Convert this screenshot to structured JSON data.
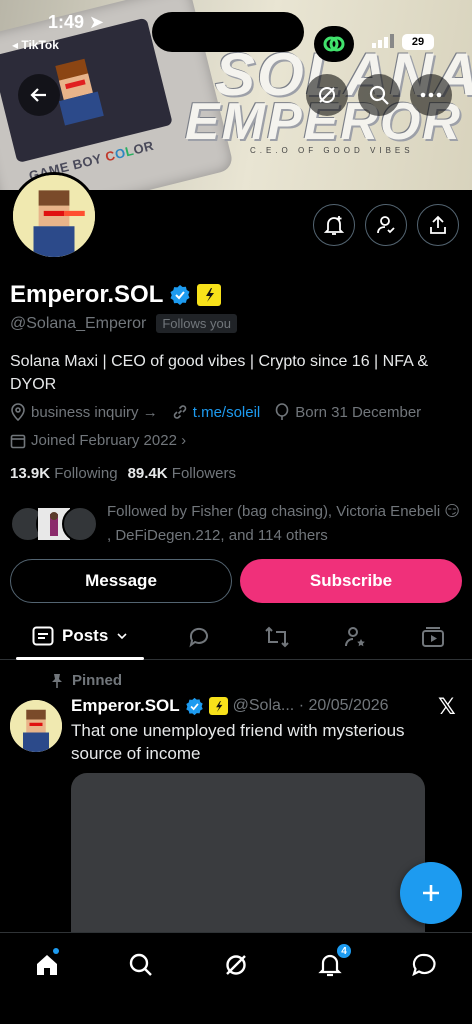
{
  "status_bar": {
    "time": "1:49",
    "back_app": "◂ TikTok",
    "battery": "29"
  },
  "banner": {
    "device_label": [
      "GAME BOY ",
      "C",
      "O",
      "L",
      "OR"
    ],
    "brand_line1": "SOLANA",
    "brand_line2": "EMPEROR",
    "tagline": "C.E.O OF GOOD VIBES"
  },
  "profile": {
    "name": "Emperor.SOL",
    "handle": "@Solana_Emperor",
    "follows_you": "Follows you",
    "bio": "Solana Maxi | CEO of good vibes | Crypto since 16 | NFA & DYOR",
    "business_inquiry": "business inquiry →",
    "link": "t.me/soleil",
    "born": "Born 31 December",
    "joined": "Joined February 2022 ›",
    "following_count": "13.9K",
    "following_label": "Following",
    "followers_count": "89.4K",
    "followers_label": "Followers",
    "followed_by": "Followed by Fisher (bag chasing), Victoria Enebeli 😏 , DeFiDegen.212, and 114 others"
  },
  "buttons": {
    "message": "Message",
    "subscribe": "Subscribe"
  },
  "tabs": {
    "active_label": "Posts"
  },
  "post": {
    "pinned_label": "Pinned",
    "author": "Emperor.SOL",
    "handle_date": "@Sola... · 20/05/2026",
    "text": "That one unemployed friend with mysterious source of income"
  },
  "bottom_nav": {
    "notifications_badge": "4"
  },
  "colors": {
    "accent": "#1d9bf0",
    "subscribe": "#f0307a",
    "gold": "#f7e11a"
  }
}
